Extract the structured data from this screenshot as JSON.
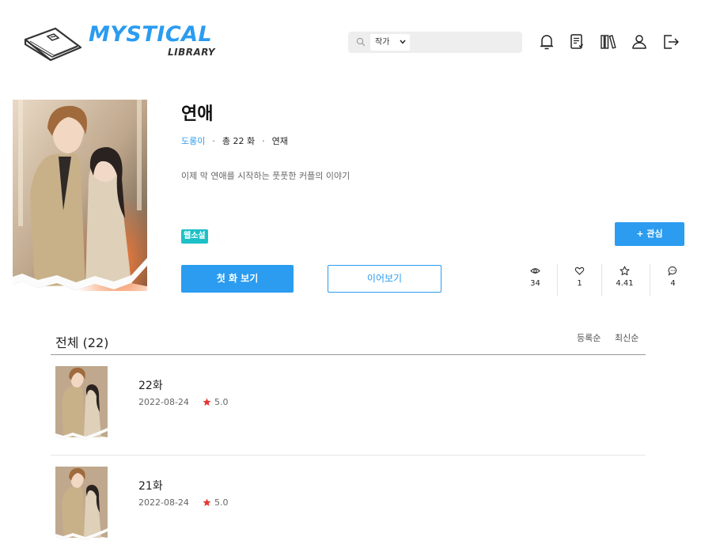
{
  "header": {
    "logo_title": "MYSTICAL",
    "logo_sub": "LIBRARY",
    "search": {
      "select_value": "작가",
      "placeholder": ""
    },
    "icons": [
      "bell-icon",
      "notes-icon",
      "bookshelf-icon",
      "user-icon",
      "logout-icon"
    ]
  },
  "work": {
    "title": "연애",
    "author": "도롱이",
    "episodes_total": "총 22 화",
    "status": "연재",
    "meta_sep": "·",
    "description": "이제 막 연애를 시작하는 풋풋한 커플의 이야기",
    "tag": "웹소설",
    "favorite_label": "+ 관심",
    "first_episode_label": "첫 화 보기",
    "continue_label": "이어보기",
    "stats": {
      "views": "34",
      "likes": "1",
      "rating": "4.41",
      "comments": "4"
    }
  },
  "episodes": {
    "heading": "전체 (22)",
    "sort_register": "등록순",
    "sort_latest": "최신순",
    "items": [
      {
        "title": "22화",
        "date": "2022-08-24",
        "rating": "5.0"
      },
      {
        "title": "21화",
        "date": "2022-08-24",
        "rating": "5.0"
      }
    ]
  },
  "colors": {
    "accent": "#2b9cf0",
    "tag": "#1ec0c7",
    "star": "#e53935"
  }
}
